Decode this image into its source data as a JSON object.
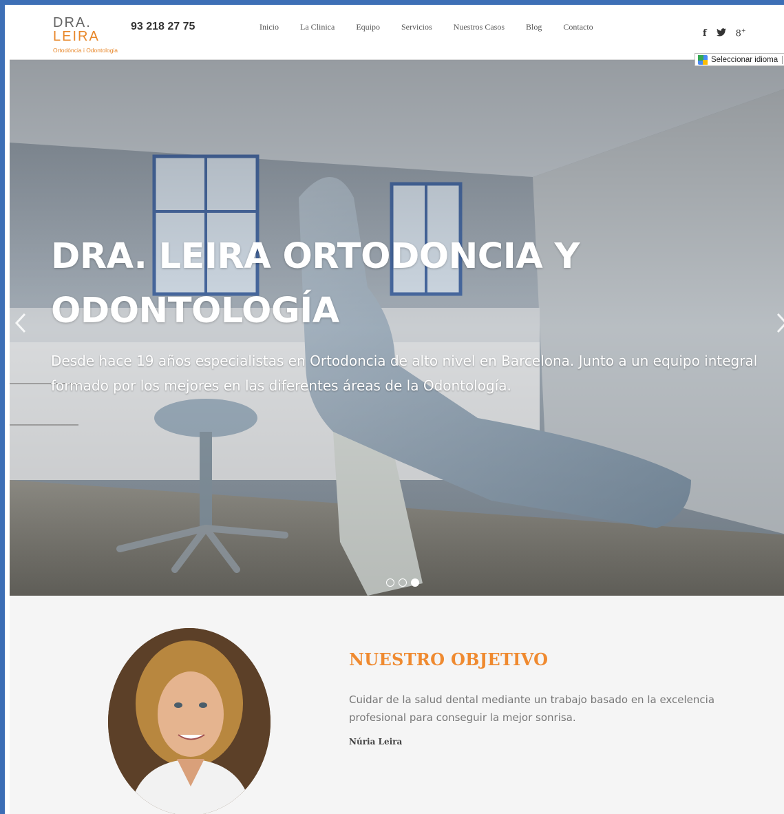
{
  "header": {
    "logo_line1": "DRA.",
    "logo_line2": "LEIRA",
    "logo_tagline": "Ortodòncia i Odontologia",
    "phone": "93 218 27 75",
    "nav": [
      "Inicio",
      "La Clinica",
      "Equipo",
      "Servicios",
      "Nuestros Casos",
      "Blog",
      "Contacto"
    ],
    "social": [
      "facebook-icon",
      "twitter-icon",
      "google-plus-icon"
    ],
    "social_glyphs": [
      "f",
      "❧",
      "8⁺"
    ],
    "language_selector": "Seleccionar idioma"
  },
  "hero": {
    "title_line1": "DRA. LEIRA ORTODONCIA Y",
    "title_line2": "ODONTOLOGÍA",
    "text_line1": "Desde hace 19 años especialistas en Ortodoncia de alto nivel en Barcelona. Junto a un equipo integral",
    "text_line2": "formado por los mejores en las diferentes áreas de la Odontología.",
    "slides_total": 3,
    "active_slide": 3
  },
  "about": {
    "title": "NUESTRO OBJETIVO",
    "text_line1": "Cuidar de la salud dental mediante un trabajo basado en la excelencia",
    "text_line2": "profesional para conseguir la mejor sonrisa.",
    "signature": "Núria Leira"
  },
  "colors": {
    "accent": "#ef8a30",
    "frame": "#3d6fb6"
  }
}
